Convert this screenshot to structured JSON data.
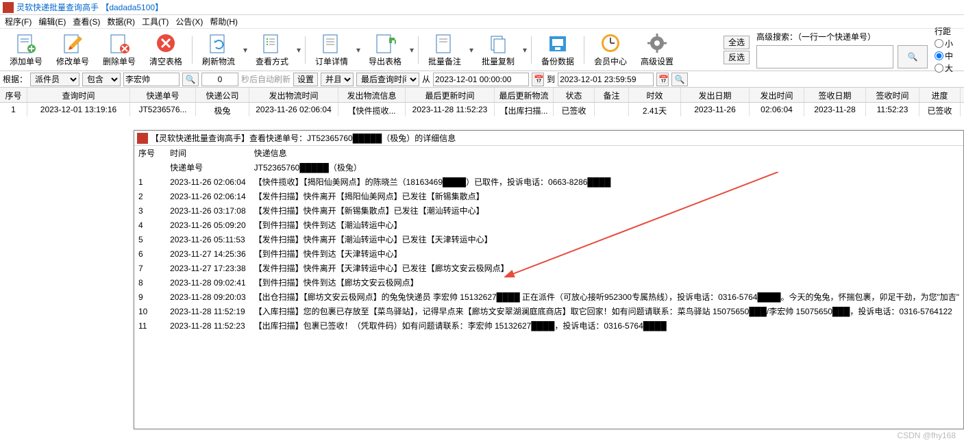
{
  "window": {
    "title": "灵软快递批量查询高手 【dadada5100】"
  },
  "menu": [
    "程序(F)",
    "编辑(E)",
    "查看(S)",
    "数据(R)",
    "工具(T)",
    "公告(X)",
    "帮助(H)"
  ],
  "toolbar": {
    "add": "添加单号",
    "edit": "修改单号",
    "del": "删除单号",
    "clear": "清空表格",
    "refresh": "刷新物流",
    "lookup": "查看方式",
    "detail": "订单详情",
    "export": "导出表格",
    "remark": "批量备注",
    "copy": "批量复制",
    "backup": "备份数据",
    "vip": "会员中心",
    "settings": "高级设置",
    "selall": "全选",
    "invsel": "反选"
  },
  "adv": {
    "title": "高级搜索：（一行一个快递单号）",
    "btn": "🔍"
  },
  "spacing": {
    "title": "行距",
    "small": "小",
    "mid": "中",
    "large": "大"
  },
  "filter": {
    "rootlbl": "根据：",
    "root": "派件员",
    "op": "包含",
    "val": "李宏帅",
    "count": "0",
    "autolbl": "秒后自动刷新",
    "setbtn": "设置",
    "andbtn": "并且",
    "lasttime": "最后查询时间",
    "from": "从",
    "date1": "2023-12-01 00:00:00",
    "to": "到",
    "date2": "2023-12-01 23:59:59"
  },
  "grid": {
    "hdr": [
      "序号",
      "查询时间",
      "快递单号",
      "快递公司",
      "发出物流时间",
      "发出物流信息",
      "最后更新时间",
      "最后更新物流",
      "状态",
      "备注",
      "时效",
      "发出日期",
      "发出时间",
      "签收日期",
      "签收时间",
      "进度"
    ],
    "row": [
      "1",
      "2023-12-01 13:19:16",
      "JT5236576...",
      "极兔",
      "2023-11-26 02:06:04",
      "【快件揽收...",
      "2023-11-28 11:52:23",
      "【出库扫描...",
      "已签收",
      "",
      "2.41天",
      "2023-11-26",
      "02:06:04",
      "2023-11-28",
      "11:52:23",
      "已签收"
    ]
  },
  "sub": {
    "title": "【灵软快递批量查询高手】查看快递单号：JT52365760█████（极兔）的详细信息",
    "hdr": [
      "序号",
      "时间",
      "快递信息"
    ],
    "track_lbl": "快递单号",
    "track_no": "JT52365760█████（极兔）",
    "rows": [
      {
        "i": "1",
        "t": "2023-11-26 02:06:04",
        "m": "【快件揽收】【揭阳仙美网点】的陈晓兰（18163469████）已取件，投诉电话：0663-8286████"
      },
      {
        "i": "2",
        "t": "2023-11-26 02:06:14",
        "m": "【发件扫描】快件离开【揭阳仙美网点】已发往【新锡集散点】"
      },
      {
        "i": "3",
        "t": "2023-11-26 03:17:08",
        "m": "【发件扫描】快件离开【新锡集散点】已发往【潮汕转运中心】"
      },
      {
        "i": "4",
        "t": "2023-11-26 05:09:20",
        "m": "【到件扫描】快件到达【潮汕转运中心】"
      },
      {
        "i": "5",
        "t": "2023-11-26 05:11:53",
        "m": "【发件扫描】快件离开【潮汕转运中心】已发往【天津转运中心】"
      },
      {
        "i": "6",
        "t": "2023-11-27 14:25:36",
        "m": "【到件扫描】快件到达【天津转运中心】"
      },
      {
        "i": "7",
        "t": "2023-11-27 17:23:38",
        "m": "【发件扫描】快件离开【天津转运中心】已发往【廊坊文安云极网点】"
      },
      {
        "i": "8",
        "t": "2023-11-28 09:02:41",
        "m": "【到件扫描】快件到达【廊坊文安云极网点】"
      },
      {
        "i": "9",
        "t": "2023-11-28 09:20:03",
        "m": "【出仓扫描】【廊坊文安云极网点】的兔兔快递员 李宏帅 15132627████ 正在派件（可放心接听952300专属热线），投诉电话：0316-5764████。今天的兔兔，怀揣包裹，卯足干劲，为您\"加吉\""
      },
      {
        "i": "10",
        "t": "2023-11-28 11:52:19",
        "m": "【入库扫描】您的包裹已存放至【菜鸟驿站】，记得早点来【廊坊文安翠湖澜庭底商店】取它回家！如有问题请联系：菜鸟驿站 15075650███/李宏帅 15075650███，投诉电话：0316-5764122"
      },
      {
        "i": "11",
        "t": "2023-11-28 11:52:23",
        "m": "【出库扫描】包裹已签收！（凭取件码）如有问题请联系：李宏帅 15132627████，投诉电话：0316-5764████"
      }
    ]
  },
  "watermark": "CSDN @fhy168"
}
